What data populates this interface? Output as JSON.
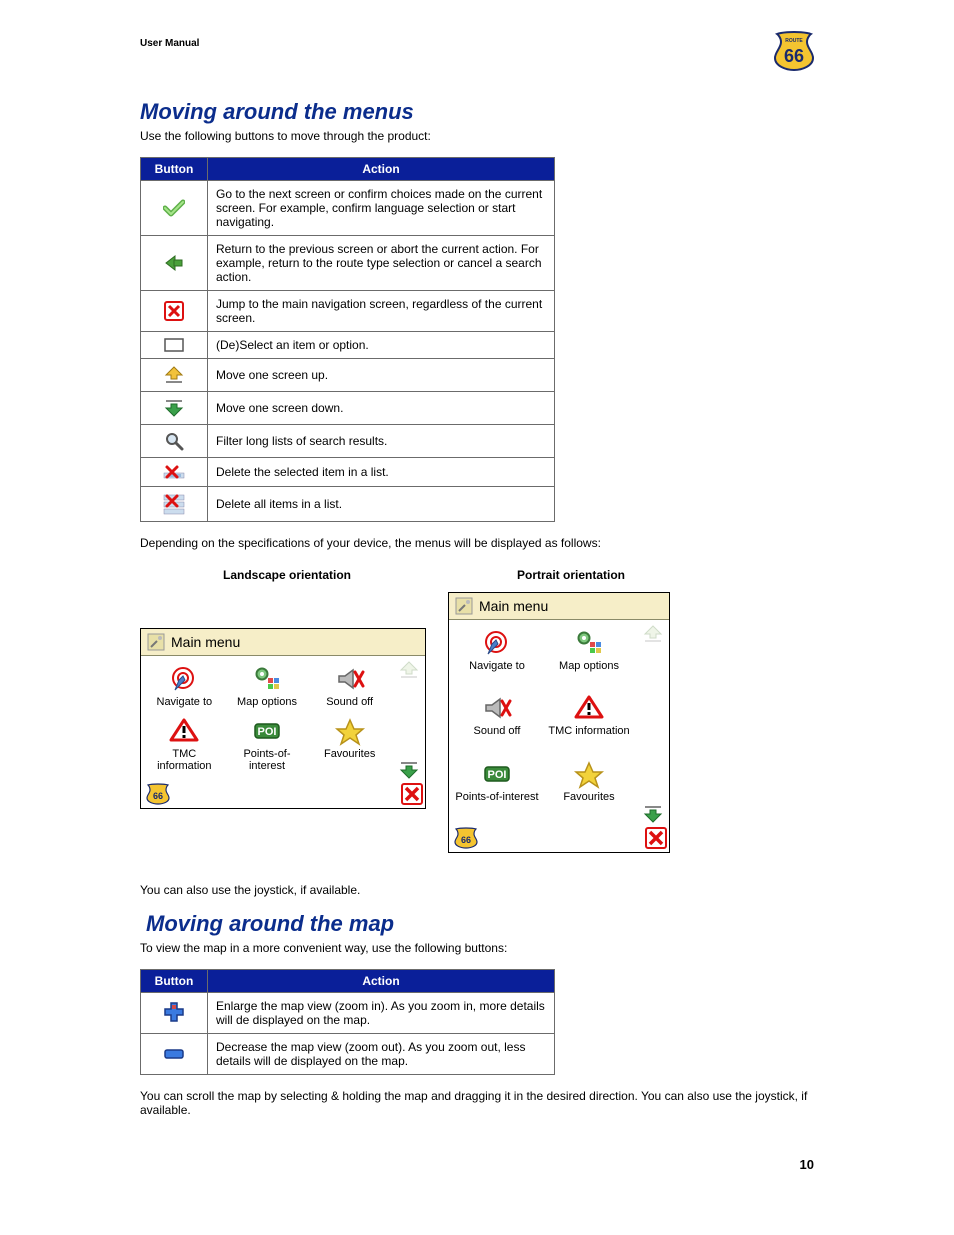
{
  "header": {
    "label": "User Manual"
  },
  "section1": {
    "title": "Moving around the menus",
    "lead": "Use the following buttons to move through the product:",
    "table": {
      "col_button": "Button",
      "col_action": "Action",
      "rows": [
        {
          "icon": "check",
          "action": "Go to the next screen or confirm choices made on the current screen. For example, confirm language selection or start navigating."
        },
        {
          "icon": "back",
          "action": "Return to the previous screen or abort the current action. For example, return to the route type selection or cancel a search action."
        },
        {
          "icon": "close",
          "action": "Jump to the main navigation screen, regardless of the current screen."
        },
        {
          "icon": "box",
          "action": "(De)Select an item or option."
        },
        {
          "icon": "up",
          "action": "Move one screen up."
        },
        {
          "icon": "down",
          "action": "Move one screen down."
        },
        {
          "icon": "search",
          "action": "Filter long lists of search results."
        },
        {
          "icon": "del",
          "action": "Delete the selected item in a list."
        },
        {
          "icon": "delall",
          "action": "Delete all items in a list."
        }
      ]
    },
    "after_table": "Depending on the specifications of your device, the menus will be displayed as follows:",
    "orient": {
      "landscape": "Landscape orientation",
      "portrait": "Portrait orientation"
    },
    "mainmenu_title": "Main menu",
    "items": {
      "navigate": "Navigate to",
      "mapopt": "Map options",
      "soundoff": "Sound off",
      "tmc": "TMC information",
      "poi": "Points-of-interest",
      "fav": "Favourites"
    },
    "joystick_note": "You can also use the joystick, if available."
  },
  "section2": {
    "title": "Moving around the map",
    "lead": "To view the map in a more convenient way, use the following buttons:",
    "table": {
      "col_button": "Button",
      "col_action": "Action",
      "rows": [
        {
          "icon": "plus",
          "action": "Enlarge the map view (zoom in). As you zoom in, more details will de displayed on the map."
        },
        {
          "icon": "minus",
          "action": "Decrease the map view (zoom out). As you zoom out, less details will de displayed on the map."
        }
      ]
    },
    "after": "You can scroll the map by selecting & holding the map and dragging it in the desired direction. You can also use the joystick, if available."
  },
  "page_number": "10"
}
